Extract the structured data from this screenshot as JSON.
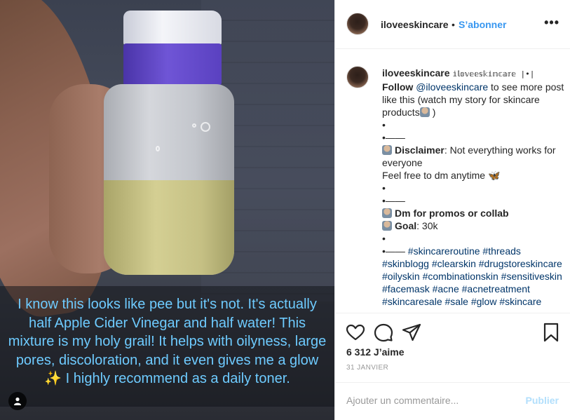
{
  "photo": {
    "caption": "I know this looks like pee but it's not. It's actually half Apple Cider Vinegar and half water! This mixture is my holy grail! It helps with oilyness, large pores, discoloration, and it even gives me a glow ✨ I highly recommend as a daily toner.",
    "user_tag_icon": "user-icon"
  },
  "header": {
    "username": "iloveeskincare",
    "dot": "•",
    "follow_label": "S’abonner",
    "more_icon": "more-icon",
    "more_glyph": "•••"
  },
  "comment": {
    "username": "iloveeskincare",
    "fancy_name": "𝕚𝕝𝕠𝕧𝕖𝕖𝕤𝕜𝕚𝕟𝕔𝕒𝕣𝕖 |•|",
    "follow_word": "Follow",
    "mention": "@iloveeskincare",
    "line1_rest": "to see more post like this (watch my story for skincare products",
    "line1_end": ")",
    "bullet": "•",
    "bullet_line": "•——",
    "disclaimer_label": "Disclaimer",
    "disclaimer_text": ": Not everything works for everyone",
    "dm_text": "Feel free to dm anytime",
    "butterfly": "🦋",
    "promos_label": "Dm for promos or collab",
    "goal_label": "Goal",
    "goal_text": ": 30k",
    "hashtags_prefix": "•——",
    "hashtags": [
      "#skincareroutine",
      "#threads",
      "#skinblogg",
      "#clearskin",
      "#drugstoreskincare",
      "#oilyskin",
      "#combinationskin",
      "#sensitiveskin",
      "#facemask",
      "#acne",
      "#acnetreatment",
      "#skincaresale",
      "#sale",
      "#glow",
      "#skincare"
    ]
  },
  "actions": {
    "like_icon": "heart-icon",
    "comment_icon": "comment-icon",
    "share_icon": "share-icon",
    "save_icon": "bookmark-icon",
    "likes": "6 312 J’aime",
    "date": "31 JANVIER"
  },
  "add_comment": {
    "placeholder": "Ajouter un commentaire...",
    "post_label": "Publier"
  },
  "colors": {
    "accent": "#3897f0",
    "caption": "#6ecbff",
    "link": "#003569",
    "muted": "#999999",
    "post_disabled": "#b2dffc"
  }
}
